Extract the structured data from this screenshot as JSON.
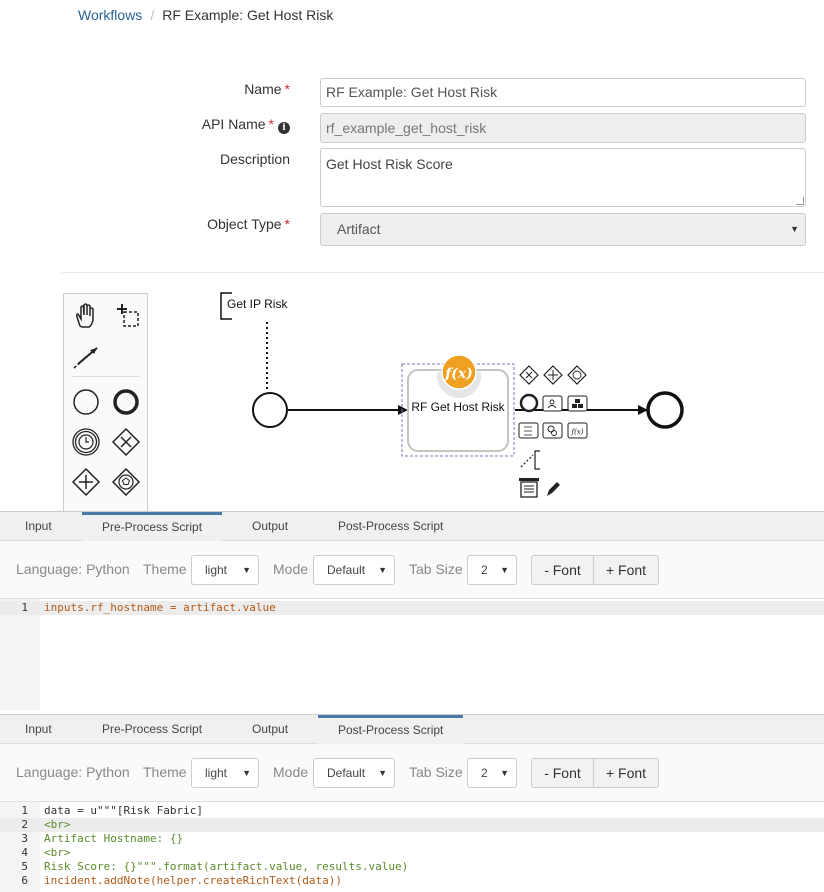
{
  "breadcrumb": {
    "root": "Workflows",
    "separator": "/",
    "current": "RF Example: Get Host Risk"
  },
  "form": {
    "name_label": "Name",
    "name_value": "RF Example: Get Host Risk",
    "api_name_label": "API Name",
    "api_name_value": "rf_example_get_host_risk",
    "description_label": "Description",
    "description_value": "Get Host Risk Score",
    "object_type_label": "Object Type",
    "object_type_value": "Artifact",
    "required_mark": "*",
    "info_glyph": "i"
  },
  "diagram": {
    "annotation": "Get IP Risk",
    "task_label": "RF Get Host Risk",
    "function_badge": "f(x)",
    "pad_fx_label": "f(x)"
  },
  "panel1": {
    "tabs": [
      "Input",
      "Pre-Process Script",
      "Output",
      "Post-Process Script"
    ],
    "active_tab": "Pre-Process Script",
    "language": "Language: Python",
    "theme_label": "Theme",
    "theme_value": "light",
    "mode_label": "Mode",
    "mode_value": "Default",
    "tabsize_label": "Tab Size",
    "tabsize_value": "2",
    "font_minus": "- Font",
    "font_plus": "+ Font",
    "code": [
      {
        "n": "1",
        "text": "inputs.rf_hostname = artifact.value"
      }
    ]
  },
  "panel2": {
    "tabs": [
      "Input",
      "Pre-Process Script",
      "Output",
      "Post-Process Script"
    ],
    "active_tab": "Post-Process Script",
    "language": "Language: Python",
    "theme_label": "Theme",
    "theme_value": "light",
    "mode_label": "Mode",
    "mode_value": "Default",
    "tabsize_label": "Tab Size",
    "tabsize_value": "2",
    "font_minus": "- Font",
    "font_plus": "+ Font",
    "code": [
      {
        "n": "1",
        "text": "data = u\"\"\"[Risk Fabric]"
      },
      {
        "n": "2",
        "text": "<br>"
      },
      {
        "n": "3",
        "text": "Artifact Hostname: {}"
      },
      {
        "n": "4",
        "text": "<br>"
      },
      {
        "n": "5",
        "text": "Risk Score: {}\"\"\".format(artifact.value, results.value)"
      },
      {
        "n": "6",
        "text": "incident.addNote(helper.createRichText(data))"
      }
    ]
  },
  "colors": {
    "link": "#2a6496",
    "required": "#c9302c",
    "function_badge": "#f0a020",
    "active_tab": "#4a7aa8"
  },
  "icons": [
    "hand-tool-icon",
    "lasso-tool-icon",
    "connect-tool-icon",
    "start-event-icon",
    "end-event-icon",
    "timer-event-icon",
    "exclusive-gateway-icon",
    "parallel-gateway-icon",
    "event-gateway-icon",
    "info-icon",
    "edit-icon",
    "delete-icon"
  ]
}
